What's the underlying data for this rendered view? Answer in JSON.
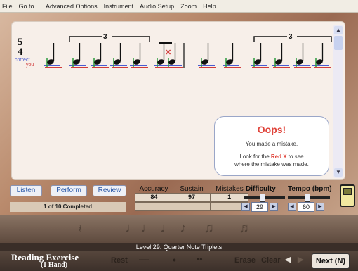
{
  "menu": [
    "File",
    "Go to...",
    "Advanced Options",
    "Instrument",
    "Audio Setup",
    "Zoom",
    "Help"
  ],
  "score": {
    "time_signature_top": "5",
    "time_signature_bottom": "4",
    "legend_correct": "correct",
    "legend_you": "you",
    "triplet_label": "3",
    "colors": {
      "correct": "#2a9a3a",
      "you": "#d03a3a",
      "line": "#4a5ad0"
    }
  },
  "feedback": {
    "title": "Oops!",
    "line1": "You made a mistake.",
    "line2_prefix": "Look for the ",
    "line2_highlight": "Red X",
    "line2_suffix": " to see",
    "line3": "where the mistake was made."
  },
  "controls": {
    "listen": "Listen",
    "perform": "Perform",
    "review": "Review",
    "completed": "1 of 10 Completed"
  },
  "stats": {
    "headers": [
      "Accuracy",
      "Sustain",
      "Mistakes"
    ],
    "values": [
      "84",
      "97",
      "1"
    ]
  },
  "difficulty": {
    "label": "Difficulty",
    "value": "29"
  },
  "tempo": {
    "label": "Tempo (bpm)",
    "value": "60"
  },
  "level": "Level 29: Quarter Note Triplets",
  "bottom": {
    "title": "Reading Exercise",
    "subtitle": "(1 Hand)",
    "rest": "Rest",
    "erase": "Erase",
    "clear": "Clear",
    "next": "Next (N)"
  }
}
